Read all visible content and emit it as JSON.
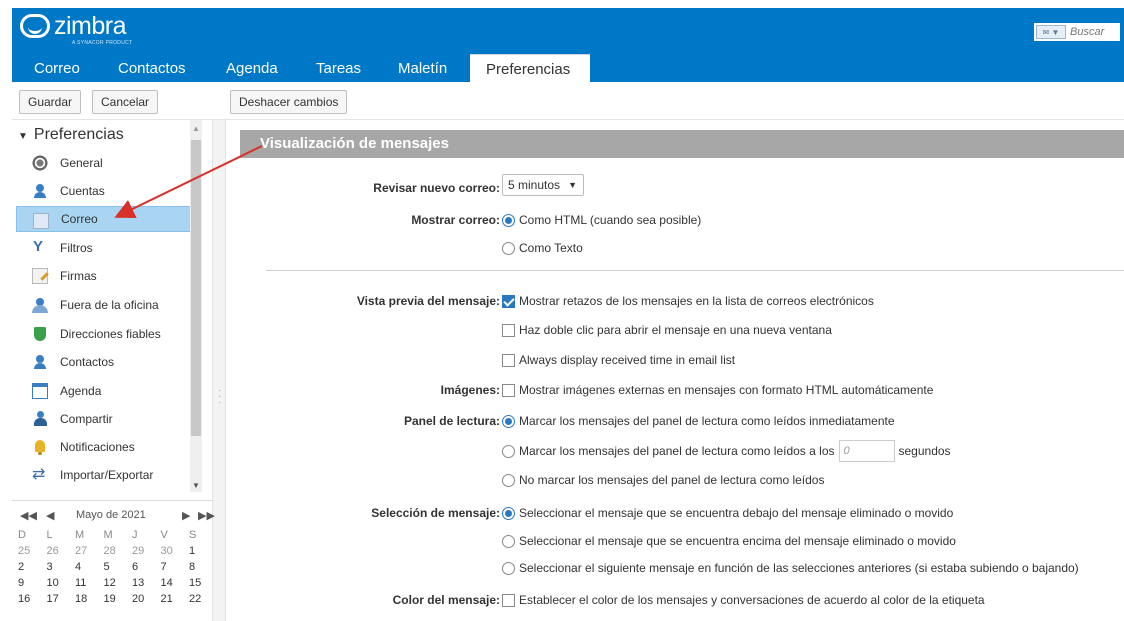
{
  "header": {
    "logo_text": "zimbra",
    "logo_sub": "A SYNACOR PRODUCT",
    "search_placeholder": "Buscar"
  },
  "nav": {
    "tabs": [
      {
        "label": "Correo"
      },
      {
        "label": "Contactos"
      },
      {
        "label": "Agenda"
      },
      {
        "label": "Tareas"
      },
      {
        "label": "Maletín"
      },
      {
        "label": "Preferencias"
      }
    ],
    "active": "Preferencias"
  },
  "toolbar": {
    "save_label": "Guardar",
    "cancel_label": "Cancelar",
    "undo_label": "Deshacer cambios"
  },
  "sidebar": {
    "title": "Preferencias",
    "items": [
      {
        "label": "General",
        "icon": "gear-icon"
      },
      {
        "label": "Cuentas",
        "icon": "accounts-icon"
      },
      {
        "label": "Correo",
        "icon": "envelope-icon",
        "selected": true
      },
      {
        "label": "Filtros",
        "icon": "filter-icon"
      },
      {
        "label": "Firmas",
        "icon": "signature-icon"
      },
      {
        "label": "Fuera de la oficina",
        "icon": "out-of-office-icon"
      },
      {
        "label": "Direcciones fiables",
        "icon": "shield-icon"
      },
      {
        "label": "Contactos",
        "icon": "contacts-icon"
      },
      {
        "label": "Agenda",
        "icon": "calendar-icon"
      },
      {
        "label": "Compartir",
        "icon": "share-icon"
      },
      {
        "label": "Notificaciones",
        "icon": "bell-icon"
      },
      {
        "label": "Importar/Exportar",
        "icon": "import-export-icon"
      }
    ]
  },
  "calendar": {
    "month_label": "Mayo de 2021",
    "prev_year": "◀◀",
    "prev_month": "◀",
    "next_month": "▶",
    "next_year": "▶▶",
    "days_of_week": [
      "D",
      "L",
      "M",
      "M",
      "J",
      "V",
      "S"
    ],
    "weeks": [
      [
        "25",
        "26",
        "27",
        "28",
        "29",
        "30",
        "1"
      ],
      [
        "2",
        "3",
        "4",
        "5",
        "6",
        "7",
        "8"
      ],
      [
        "9",
        "10",
        "11",
        "12",
        "13",
        "14",
        "15"
      ],
      [
        "16",
        "17",
        "18",
        "19",
        "20",
        "21",
        "22"
      ]
    ]
  },
  "main": {
    "section_title": "Visualización de mensajes",
    "check_new_mail": {
      "label": "Revisar nuevo correo:",
      "value": "5 minutos"
    },
    "show_mail": {
      "label": "Mostrar correo:",
      "options": [
        {
          "text": "Como HTML (cuando sea posible)",
          "checked": true
        },
        {
          "text": "Como Texto",
          "checked": false
        }
      ]
    },
    "preview": {
      "label": "Vista previa del mensaje:",
      "options": [
        {
          "text": "Mostrar retazos de los mensajes en la lista de correos electrónicos",
          "checked": true
        },
        {
          "text": "Haz doble clic para abrir el mensaje en una nueva ventana",
          "checked": false
        },
        {
          "text": "Always display received time in email list",
          "checked": false
        }
      ]
    },
    "images": {
      "label": "Imágenes:",
      "option": {
        "text": "Mostrar imágenes externas en mensajes con formato HTML automáticamente",
        "checked": false
      }
    },
    "reading_pane": {
      "label": "Panel de lectura:",
      "opt1": "Marcar los mensajes del panel de lectura como leídos inmediatamente",
      "opt2_prefix": "Marcar los mensajes del panel de lectura como leídos a los",
      "opt2_value": "0",
      "opt2_suffix": "segundos",
      "opt3": "No marcar los mensajes del panel de lectura como leídos"
    },
    "selection": {
      "label": "Selección de mensaje:",
      "options": [
        {
          "text": "Seleccionar el mensaje que se encuentra debajo del mensaje eliminado o movido",
          "checked": true
        },
        {
          "text": "Seleccionar el mensaje que se encuentra encima del mensaje eliminado o movido",
          "checked": false
        },
        {
          "text": "Seleccionar el siguiente mensaje en función de las selecciones anteriores (si estaba subiendo o bajando)",
          "checked": false
        }
      ]
    },
    "color": {
      "label": "Color del mensaje:",
      "option": {
        "text": "Establecer el color de los mensajes y conversaciones de acuerdo al color de la etiqueta",
        "checked": false
      }
    }
  },
  "colors": {
    "brand_blue": "#0078c8",
    "selected_bg": "#a9d5f2",
    "section_header": "#a7a7a7",
    "annotation_arrow": "#d9302a"
  }
}
